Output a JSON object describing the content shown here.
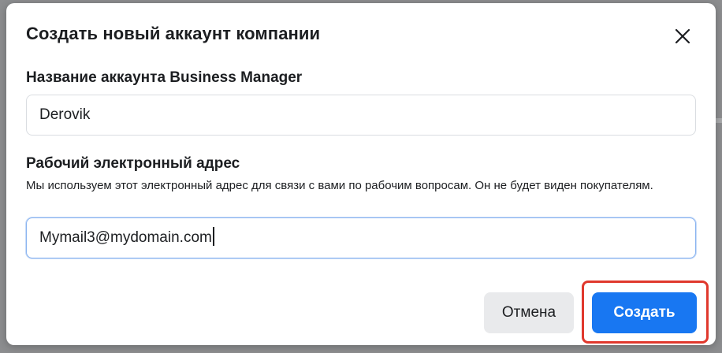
{
  "dialog": {
    "title": "Создать новый аккаунт компании",
    "close_icon": "close-icon"
  },
  "fields": {
    "account_name": {
      "label": "Название аккаунта Business Manager",
      "value": "Derovik"
    },
    "email": {
      "label": "Рабочий электронный адрес",
      "help": "Мы используем этот электронный адрес для связи с вами по рабочим вопросам. Он не будет виден покупателям.",
      "value": "Mymail3@mydomain.com"
    }
  },
  "buttons": {
    "cancel_label": "Отмена",
    "create_label": "Создать"
  },
  "colors": {
    "primary": "#1877f2",
    "highlight": "#e0382d",
    "secondary_bg": "#e9eaec"
  }
}
